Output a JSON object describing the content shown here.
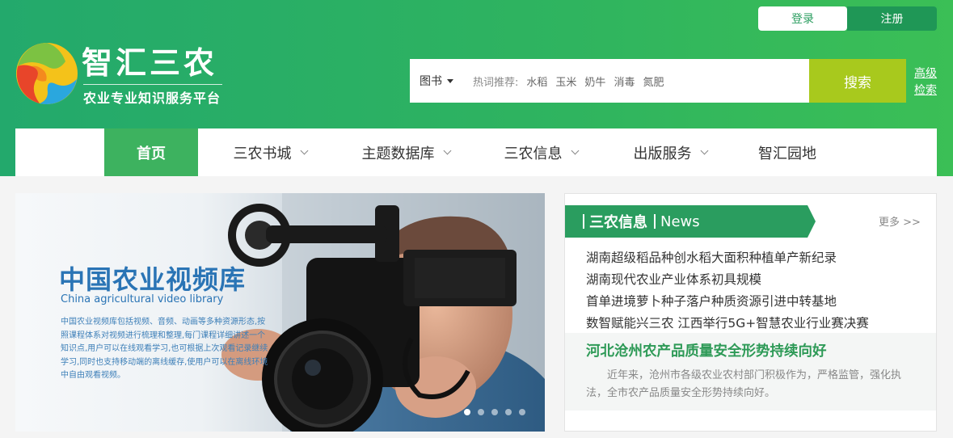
{
  "header": {
    "login": "登录",
    "register": "注册",
    "logo_title": "智汇三农",
    "logo_subtitle": "农业专业知识服务平台"
  },
  "search": {
    "type": "图书",
    "hot_label": "热词推荐:",
    "hot_words": [
      "水稻",
      "玉米",
      "奶牛",
      "消毒",
      "氮肥"
    ],
    "button": "搜索",
    "advanced": "高级检索"
  },
  "nav": {
    "items": [
      {
        "label": "首页",
        "active": true,
        "dropdown": false
      },
      {
        "label": "三农书城",
        "active": false,
        "dropdown": true
      },
      {
        "label": "主题数据库",
        "active": false,
        "dropdown": true
      },
      {
        "label": "三农信息",
        "active": false,
        "dropdown": true
      },
      {
        "label": "出版服务",
        "active": false,
        "dropdown": true
      },
      {
        "label": "智汇园地",
        "active": false,
        "dropdown": false
      }
    ]
  },
  "banner": {
    "title": "中国农业视频库",
    "subtitle": "China agricultural video library",
    "description": "中国农业视频库包括视频、音频、动画等多种资源形态,按照课程体系对视频进行梳理和整理,每门课程详细讲述一个知识点,用户可以在线观看学习,也可根据上次观看记录继续学习,同时也支持移动端的离线缓存,使用户可以在离线环境中自由观看视频。",
    "slides": 5,
    "active_slide": 1
  },
  "news": {
    "title": "三农信息",
    "title_en": "News",
    "more": "更多 >>",
    "items": [
      "湖南超级稻品种创水稻大面积种植单产新纪录",
      "湖南现代农业产业体系初具规模",
      "首单进境萝卜种子落户种质资源引进中转基地",
      "数智赋能兴三农 江西举行5G+智慧农业行业赛决赛"
    ],
    "featured": {
      "title": "河北沧州农产品质量安全形势持续向好",
      "summary": "近年来，沧州市各级农业农村部门积极作为，严格监管，强化执法，全市农产品质量安全形势持续向好。"
    }
  },
  "colors": {
    "header_green": "#2fb45f",
    "nav_active": "#3db25f",
    "search_button": "#a8c91d",
    "news_banner": "#2a9d5f",
    "featured_title": "#2e9a57"
  }
}
